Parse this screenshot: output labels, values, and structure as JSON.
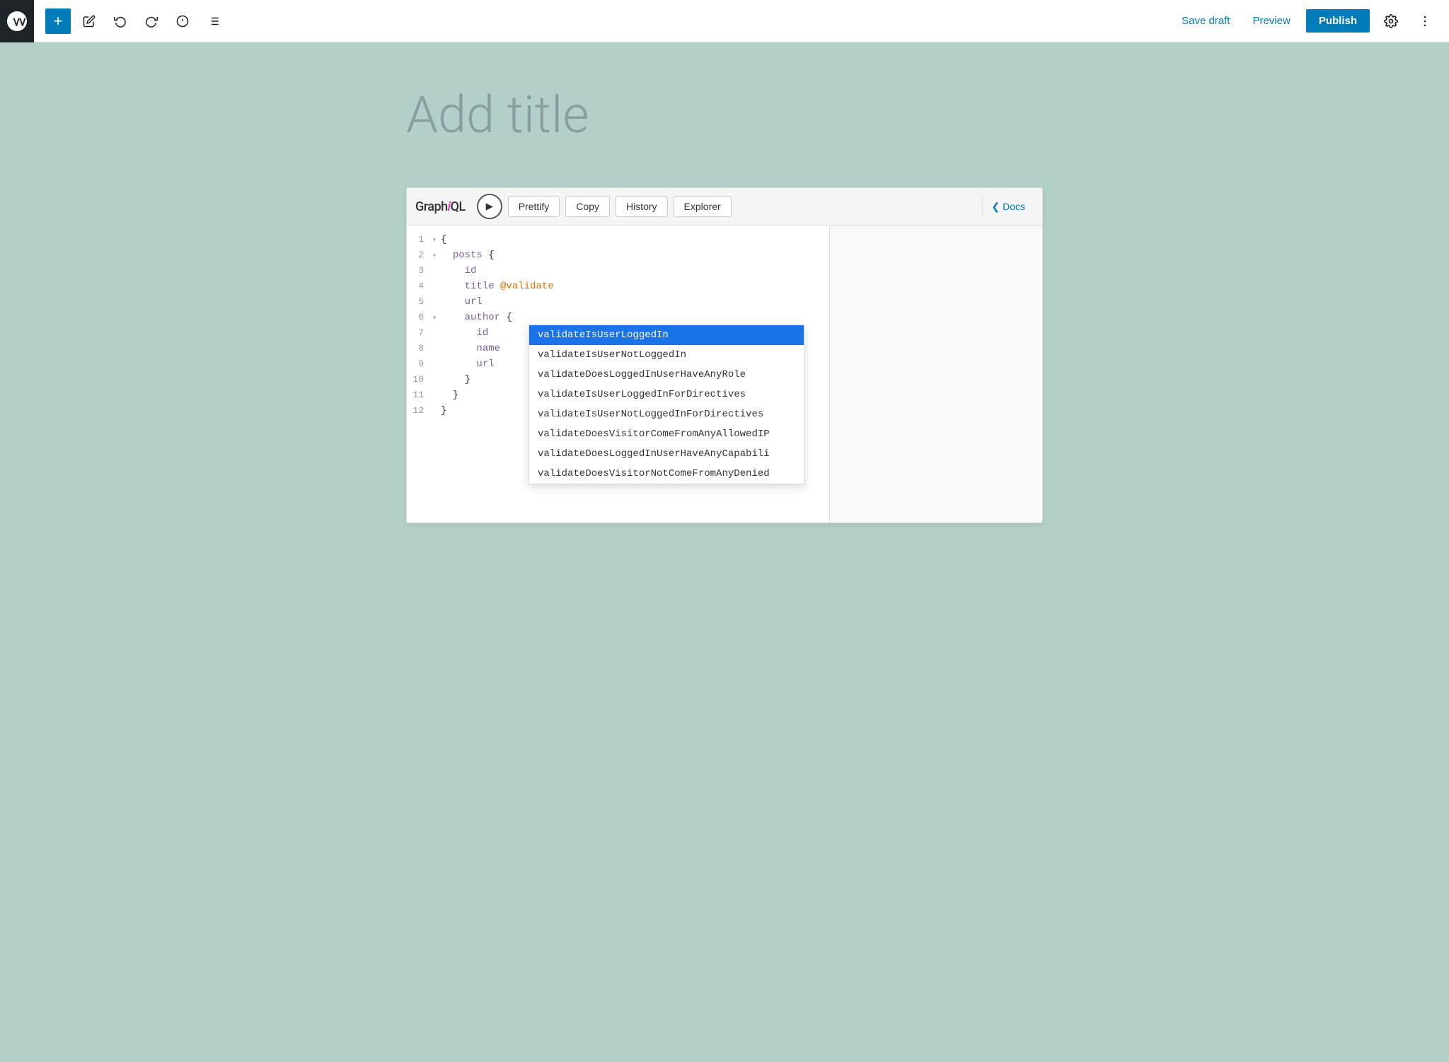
{
  "toolbar": {
    "add_label": "+",
    "save_draft_label": "Save draft",
    "preview_label": "Preview",
    "publish_label": "Publish"
  },
  "page": {
    "title_placeholder": "Add title"
  },
  "graphiql": {
    "logo": "GraphiQL",
    "logo_italic": "i",
    "run_icon": "▶",
    "buttons": {
      "prettify": "Prettify",
      "copy": "Copy",
      "history": "History",
      "explorer": "Explorer",
      "docs": "Docs"
    },
    "code_lines": [
      {
        "num": "1",
        "arrow": "▾",
        "content": "{",
        "type": "punct"
      },
      {
        "num": "2",
        "arrow": "▾",
        "indent": 2,
        "field": "posts",
        "brace": "{"
      },
      {
        "num": "3",
        "arrow": "",
        "indent": 4,
        "field": "id"
      },
      {
        "num": "4",
        "arrow": "",
        "indent": 4,
        "field": "title",
        "directive": "@validate"
      },
      {
        "num": "5",
        "arrow": "",
        "indent": 4,
        "field": "url"
      },
      {
        "num": "6",
        "arrow": "▾",
        "indent": 4,
        "field": "author",
        "brace": "{"
      },
      {
        "num": "7",
        "arrow": "",
        "indent": 6,
        "field": "id"
      },
      {
        "num": "8",
        "arrow": "",
        "indent": 6,
        "field": "name"
      },
      {
        "num": "9",
        "arrow": "",
        "indent": 6,
        "field": "url"
      },
      {
        "num": "10",
        "arrow": "",
        "indent": 4,
        "brace_only": "}"
      },
      {
        "num": "11",
        "arrow": "",
        "indent": 2,
        "brace_only": "}"
      },
      {
        "num": "12",
        "arrow": "",
        "indent": 0,
        "brace_only": "}"
      }
    ],
    "autocomplete": {
      "items": [
        {
          "label": "validateIsUserLoggedIn",
          "selected": true
        },
        {
          "label": "validateIsUserNotLoggedIn",
          "selected": false
        },
        {
          "label": "validateDoesLoggedInUserHaveAnyRole",
          "selected": false
        },
        {
          "label": "validateIsUserLoggedInForDirectives",
          "selected": false
        },
        {
          "label": "validateIsUserNotLoggedInForDirectives",
          "selected": false
        },
        {
          "label": "validateDoesVisitorComeFromAnyAllowedIP",
          "selected": false
        },
        {
          "label": "validateDoesLoggedInUserHaveAnyCapabili",
          "selected": false
        },
        {
          "label": "validateDoesVisitorNotComeFromAnyDenied",
          "selected": false
        }
      ]
    }
  }
}
